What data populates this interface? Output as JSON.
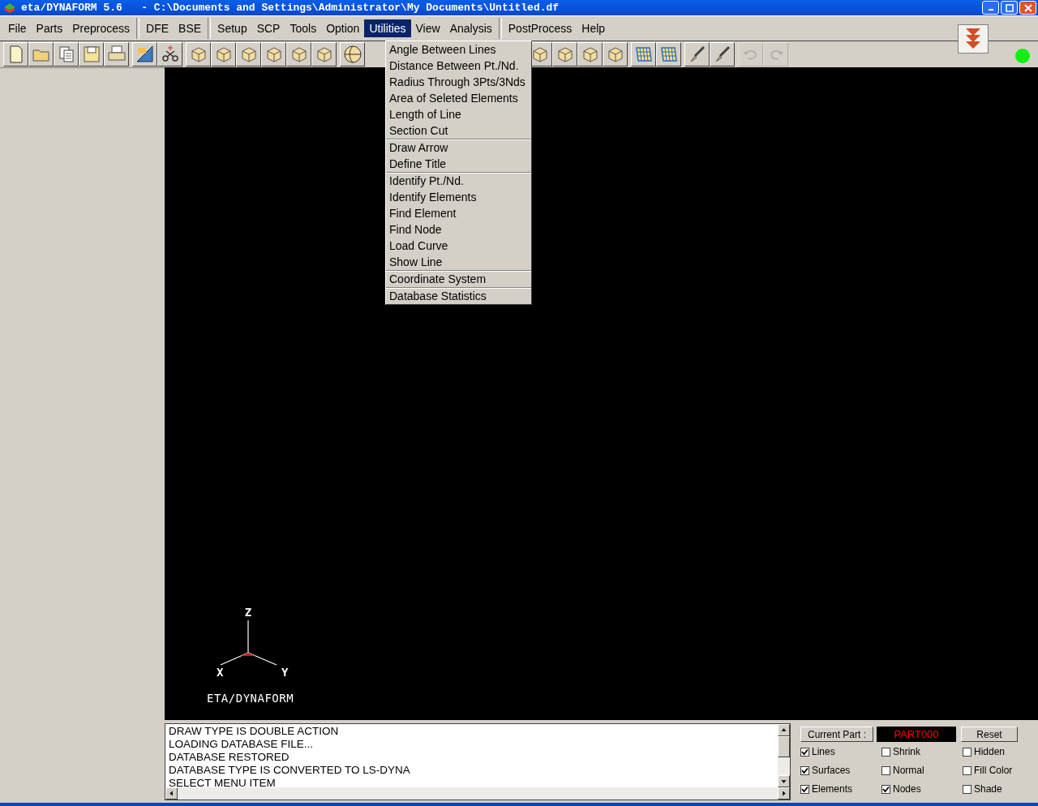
{
  "window": {
    "title": "eta/DYNAFORM 5.6   - C:\\Documents and Settings\\Administrator\\My Documents\\Untitled.df"
  },
  "menubar": [
    [
      {
        "label": "File",
        "selected": false
      },
      {
        "label": "Parts",
        "selected": false
      },
      {
        "label": "Preprocess",
        "selected": false
      }
    ],
    [
      {
        "label": "DFE",
        "selected": false
      },
      {
        "label": "BSE",
        "selected": false
      }
    ],
    [
      {
        "label": "Setup",
        "selected": false
      },
      {
        "label": "SCP",
        "selected": false
      },
      {
        "label": "Tools",
        "selected": false
      },
      {
        "label": "Option",
        "selected": false
      },
      {
        "label": "Utilities",
        "selected": true
      },
      {
        "label": "View",
        "selected": false
      },
      {
        "label": "Analysis",
        "selected": false
      }
    ],
    [
      {
        "label": "PostProcess",
        "selected": false
      },
      {
        "label": "Help",
        "selected": false
      }
    ]
  ],
  "toolbar": {
    "undo": {
      "disabled": true
    },
    "redo": {
      "disabled": true
    }
  },
  "dropdown": [
    [
      {
        "label": "Angle Between Lines"
      },
      {
        "label": "Distance Between Pt./Nd."
      },
      {
        "label": "Radius Through 3Pts/3Nds"
      },
      {
        "label": "Area of Seleted Elements"
      },
      {
        "label": "Length of Line"
      },
      {
        "label": "Section Cut"
      }
    ],
    [
      {
        "label": "Draw Arrow"
      },
      {
        "label": "Define Title"
      }
    ],
    [
      {
        "label": "Identify Pt./Nd."
      },
      {
        "label": "Identify Elements"
      },
      {
        "label": "Find Element"
      },
      {
        "label": "Find Node"
      },
      {
        "label": "Load Curve"
      },
      {
        "label": "Show Line"
      }
    ],
    [
      {
        "label": "Coordinate System"
      }
    ],
    [
      {
        "label": "Database Statistics"
      }
    ]
  ],
  "status_light": {
    "on": true
  },
  "triad": {
    "z": "Z",
    "x": "X",
    "y": "Y",
    "caption": "ETA/DYNAFORM"
  },
  "log": [
    "DRAW TYPE IS DOUBLE ACTION",
    "LOADING DATABASE FILE...",
    "DATABASE RESTORED",
    "DATABASE TYPE IS CONVERTED TO LS-DYNA",
    "SELECT MENU ITEM"
  ],
  "display_panel": {
    "current_part_button": "Current Part :",
    "current_part": "PART000",
    "reset_button": "Reset",
    "options": [
      {
        "label": "Lines",
        "checked": true
      },
      {
        "label": "Shrink",
        "checked": false
      },
      {
        "label": "Hidden",
        "checked": false
      },
      {
        "label": "Surfaces",
        "checked": true
      },
      {
        "label": "Normal",
        "checked": false
      },
      {
        "label": "Fill Color",
        "checked": false
      },
      {
        "label": "Elements",
        "checked": true
      },
      {
        "label": "Nodes",
        "checked": true
      },
      {
        "label": "Shade",
        "checked": false
      }
    ]
  }
}
